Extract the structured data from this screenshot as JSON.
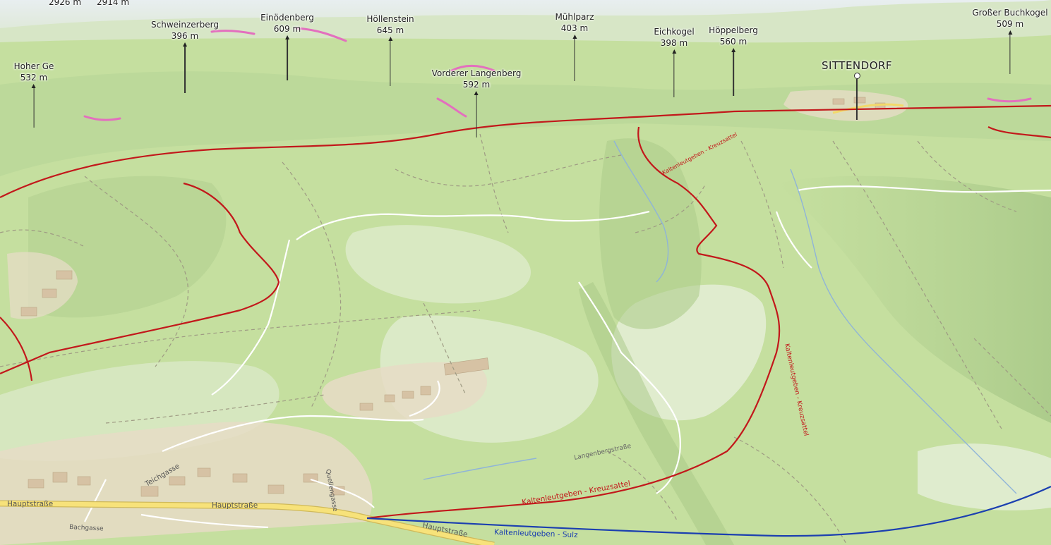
{
  "peaks": [
    {
      "name": "",
      "elevation": "2926 m"
    },
    {
      "name": "",
      "elevation": "2914 m"
    },
    {
      "name": "Schweinzerberg",
      "elevation": "396 m"
    },
    {
      "name": "Einödenberg",
      "elevation": "609 m"
    },
    {
      "name": "Höllenstein",
      "elevation": "645 m"
    },
    {
      "name": "Mühlparz",
      "elevation": "403 m"
    },
    {
      "name": "Eichkogel",
      "elevation": "398 m"
    },
    {
      "name": "Höppelberg",
      "elevation": "560 m"
    },
    {
      "name": "Großer Buchkogel",
      "elevation": "509 m"
    },
    {
      "name": "Hoher Ge",
      "elevation": "532 m"
    },
    {
      "name": "Vorderer Langenberg",
      "elevation": "592 m"
    }
  ],
  "town": {
    "name": "SITTENDORF"
  },
  "streets": {
    "hauptstrasse_1": "Hauptstraße",
    "hauptstrasse_2": "Hauptstraße",
    "hauptstrasse_3": "Hauptstraße",
    "teichgasse": "Teichgasse",
    "quellengasse": "Quellengasse",
    "bachgasse": "Bachgasse",
    "langenbergstrasse": "Langenbergstraße"
  },
  "trails": {
    "red_trail_bottom": "Kaltenleutgeben - Kreuzsattel",
    "red_trail_right": "Kaltenleutgeben - Kreuzsattel",
    "red_trail_top": "Kaltenleutgeben - Kreuzsattel",
    "blue_trail": "Kaltenleutgeben - Sulz"
  },
  "colors": {
    "meadow": "#cfe5b0",
    "forest": "#b7d695",
    "trail_red": "#c2181b",
    "trail_blue": "#1b3fb0",
    "main_road": "#f5de6c",
    "settlement": "#e4d8c2"
  }
}
